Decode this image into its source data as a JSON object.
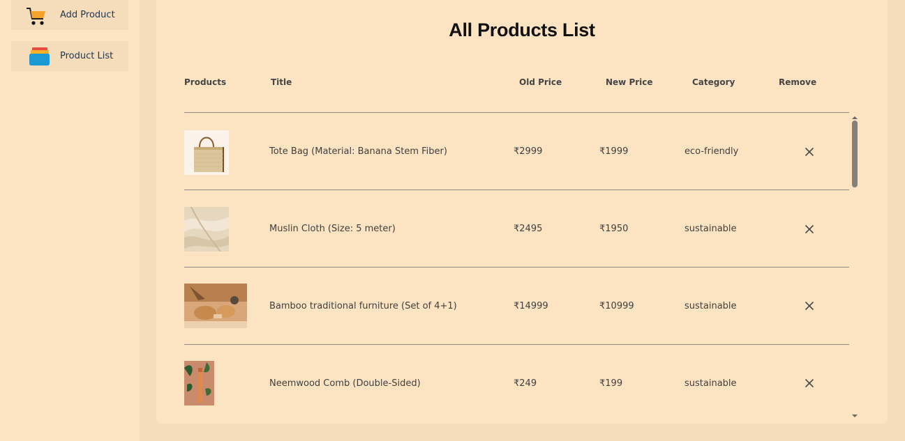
{
  "sidebar": {
    "items": [
      {
        "label": "Add Product",
        "icon": "cart-icon"
      },
      {
        "label": "Product List",
        "icon": "product-list-icon"
      }
    ]
  },
  "main": {
    "title": "All Products List",
    "columns": [
      "Products",
      "Title",
      "Old Price",
      "New Price",
      "Category",
      "Remove"
    ],
    "products": [
      {
        "title": "Tote Bag (Material: Banana Stem Fiber)",
        "old_price": "₹2999",
        "new_price": "₹1999",
        "category": "eco-friendly"
      },
      {
        "title": "Muslin Cloth (Size: 5 meter)",
        "old_price": "₹2495",
        "new_price": "₹1950",
        "category": "sustainable"
      },
      {
        "title": "Bamboo traditional furniture (Set of 4+1)",
        "old_price": "₹14999",
        "new_price": "₹10999",
        "category": "sustainable"
      },
      {
        "title": "Neemwood Comb (Double-Sided)",
        "old_price": "₹249",
        "new_price": "₹199",
        "category": "sustainable"
      }
    ]
  }
}
